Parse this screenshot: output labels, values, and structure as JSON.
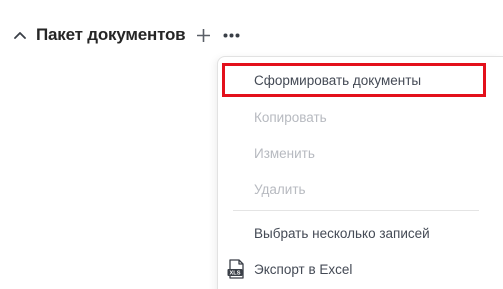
{
  "header": {
    "title": "Пакет документов",
    "collapse_icon": "chevron-up-icon",
    "add_icon": "plus-icon",
    "more_icon": "more-dots-icon"
  },
  "menu": {
    "items": [
      {
        "label": "Сформировать документы",
        "state": "enabled",
        "highlighted": true
      },
      {
        "label": "Копировать",
        "state": "disabled"
      },
      {
        "label": "Изменить",
        "state": "disabled"
      },
      {
        "label": "Удалить",
        "state": "disabled"
      },
      {
        "label": "Выбрать несколько записей",
        "state": "enabled"
      },
      {
        "label": "Экспорт в Excel",
        "state": "enabled",
        "icon": "xls-file-icon"
      }
    ]
  },
  "colors": {
    "highlight": "#e3101b",
    "text": "#444a55",
    "disabled_text": "#b7bac0",
    "title": "#262626"
  }
}
